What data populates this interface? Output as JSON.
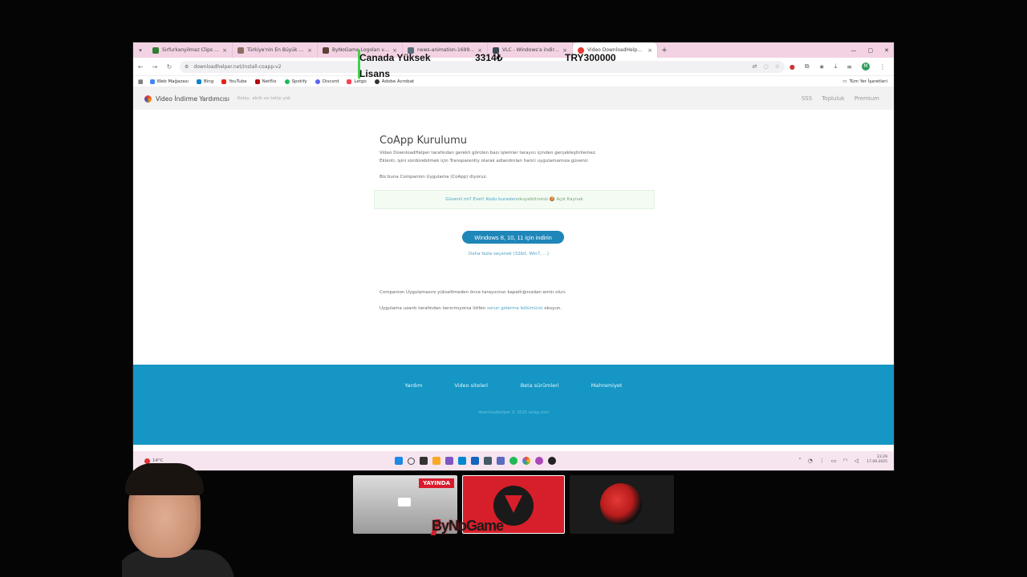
{
  "browser": {
    "tabs": [
      {
        "title": "Sirfurkanyilmaz Clips - Watch T...",
        "color": "#2e7d32"
      },
      {
        "title": "Türkiye'nin En Büyük Oyuncu S...",
        "color": "#8d6e63"
      },
      {
        "title": "ByNoGame Logoları ve Marka ...",
        "color": "#5d4037"
      },
      {
        "title": "news-animation-1699... ",
        "color": "#546e7a"
      },
      {
        "title": "VLC - Windows'a indirin ve yükl...",
        "color": "#37474f"
      },
      {
        "title": "Video DownloadHelper - CoAp...",
        "color": "#e53935"
      }
    ],
    "url": "downloadhelper.net/install-coapp-v2",
    "profile_initial": "M",
    "bookmarks": [
      "Web Mağazası",
      "Bing",
      "YouTube",
      "Netflix",
      "Spotify",
      "Discord",
      "Letgo",
      "Adobe Acrobat"
    ],
    "bookmarks_right": "Tüm Yer İşaretleri"
  },
  "site": {
    "name": "Video İndirme Yardımcısı",
    "tagline": "Kolay, akıllı ve takip yok",
    "nav": [
      "SSS",
      "Topluluk",
      "Premium"
    ],
    "title": "CoApp Kurulumu",
    "intro_line1": "Video DownloadHelper tarafından gerekli görülen bazı işlemler tarayıcı içinden gerçekleştirilemez.",
    "intro_line2": "Eklenti, işini sürdürebilmek için Transparently olarak adlandırılan harici uygulamamıza güvenir.",
    "intro_line3": "Biz buna Companion Uygulama (CoApp) diyoruz.",
    "notice_link": "Güvenli mi? Evet! Kodu buradan",
    "notice_text": " okuyabilirsiniz 🍪 Açık Kaynak",
    "download_button": "Windows 8, 10, 11 için indirin",
    "more_options": "Daha fazla seçenek (32bit, Win7, ...)",
    "outro_line1": "Companion Uygulamasını yükseltmeden önce tarayıcınızı kapattığınızdan emin olun.",
    "outro_line2_pre": "Uygulama uzantı tarafından tanınmıyorsa lütfen ",
    "outro_line2_link": "sorun giderme bölümünü",
    "outro_line2_post": " okuyun.",
    "footer_links": [
      "Yardım",
      "Video siteleri",
      "Beta sürümleri",
      "Mahremiyet"
    ],
    "footer_copy": "downloadhelper © 2025 aclap.com"
  },
  "taskbar": {
    "weather": "14°C",
    "clock_time": "23:29",
    "clock_date": "17.09.2025"
  },
  "overlay": {
    "name_line1": "Canada Yüksek",
    "name_line2": "Lisans",
    "count": "3314₺",
    "price": "TRY300000"
  },
  "stream": {
    "live_badge": "YAYINDA",
    "brand": "ByNoGame"
  }
}
